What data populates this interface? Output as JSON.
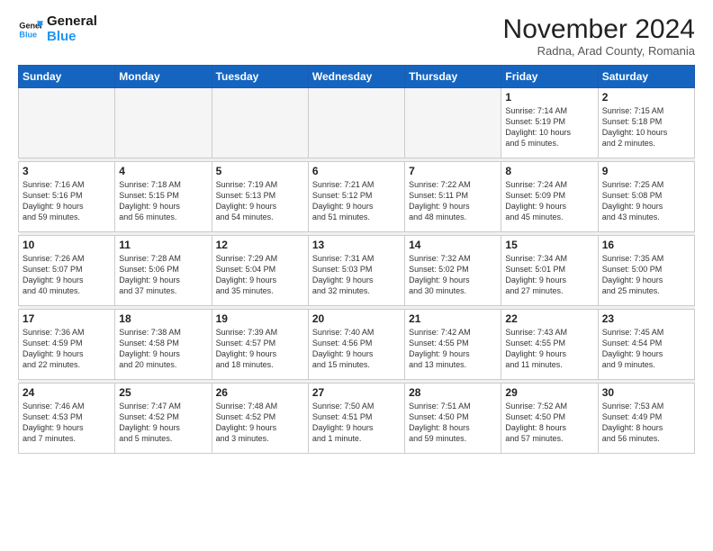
{
  "logo": {
    "line1": "General",
    "line2": "Blue"
  },
  "header": {
    "title": "November 2024",
    "subtitle": "Radna, Arad County, Romania"
  },
  "weekdays": [
    "Sunday",
    "Monday",
    "Tuesday",
    "Wednesday",
    "Thursday",
    "Friday",
    "Saturday"
  ],
  "weeks": [
    [
      {
        "day": "",
        "info": ""
      },
      {
        "day": "",
        "info": ""
      },
      {
        "day": "",
        "info": ""
      },
      {
        "day": "",
        "info": ""
      },
      {
        "day": "",
        "info": ""
      },
      {
        "day": "1",
        "info": "Sunrise: 7:14 AM\nSunset: 5:19 PM\nDaylight: 10 hours\nand 5 minutes."
      },
      {
        "day": "2",
        "info": "Sunrise: 7:15 AM\nSunset: 5:18 PM\nDaylight: 10 hours\nand 2 minutes."
      }
    ],
    [
      {
        "day": "3",
        "info": "Sunrise: 7:16 AM\nSunset: 5:16 PM\nDaylight: 9 hours\nand 59 minutes."
      },
      {
        "day": "4",
        "info": "Sunrise: 7:18 AM\nSunset: 5:15 PM\nDaylight: 9 hours\nand 56 minutes."
      },
      {
        "day": "5",
        "info": "Sunrise: 7:19 AM\nSunset: 5:13 PM\nDaylight: 9 hours\nand 54 minutes."
      },
      {
        "day": "6",
        "info": "Sunrise: 7:21 AM\nSunset: 5:12 PM\nDaylight: 9 hours\nand 51 minutes."
      },
      {
        "day": "7",
        "info": "Sunrise: 7:22 AM\nSunset: 5:11 PM\nDaylight: 9 hours\nand 48 minutes."
      },
      {
        "day": "8",
        "info": "Sunrise: 7:24 AM\nSunset: 5:09 PM\nDaylight: 9 hours\nand 45 minutes."
      },
      {
        "day": "9",
        "info": "Sunrise: 7:25 AM\nSunset: 5:08 PM\nDaylight: 9 hours\nand 43 minutes."
      }
    ],
    [
      {
        "day": "10",
        "info": "Sunrise: 7:26 AM\nSunset: 5:07 PM\nDaylight: 9 hours\nand 40 minutes."
      },
      {
        "day": "11",
        "info": "Sunrise: 7:28 AM\nSunset: 5:06 PM\nDaylight: 9 hours\nand 37 minutes."
      },
      {
        "day": "12",
        "info": "Sunrise: 7:29 AM\nSunset: 5:04 PM\nDaylight: 9 hours\nand 35 minutes."
      },
      {
        "day": "13",
        "info": "Sunrise: 7:31 AM\nSunset: 5:03 PM\nDaylight: 9 hours\nand 32 minutes."
      },
      {
        "day": "14",
        "info": "Sunrise: 7:32 AM\nSunset: 5:02 PM\nDaylight: 9 hours\nand 30 minutes."
      },
      {
        "day": "15",
        "info": "Sunrise: 7:34 AM\nSunset: 5:01 PM\nDaylight: 9 hours\nand 27 minutes."
      },
      {
        "day": "16",
        "info": "Sunrise: 7:35 AM\nSunset: 5:00 PM\nDaylight: 9 hours\nand 25 minutes."
      }
    ],
    [
      {
        "day": "17",
        "info": "Sunrise: 7:36 AM\nSunset: 4:59 PM\nDaylight: 9 hours\nand 22 minutes."
      },
      {
        "day": "18",
        "info": "Sunrise: 7:38 AM\nSunset: 4:58 PM\nDaylight: 9 hours\nand 20 minutes."
      },
      {
        "day": "19",
        "info": "Sunrise: 7:39 AM\nSunset: 4:57 PM\nDaylight: 9 hours\nand 18 minutes."
      },
      {
        "day": "20",
        "info": "Sunrise: 7:40 AM\nSunset: 4:56 PM\nDaylight: 9 hours\nand 15 minutes."
      },
      {
        "day": "21",
        "info": "Sunrise: 7:42 AM\nSunset: 4:55 PM\nDaylight: 9 hours\nand 13 minutes."
      },
      {
        "day": "22",
        "info": "Sunrise: 7:43 AM\nSunset: 4:55 PM\nDaylight: 9 hours\nand 11 minutes."
      },
      {
        "day": "23",
        "info": "Sunrise: 7:45 AM\nSunset: 4:54 PM\nDaylight: 9 hours\nand 9 minutes."
      }
    ],
    [
      {
        "day": "24",
        "info": "Sunrise: 7:46 AM\nSunset: 4:53 PM\nDaylight: 9 hours\nand 7 minutes."
      },
      {
        "day": "25",
        "info": "Sunrise: 7:47 AM\nSunset: 4:52 PM\nDaylight: 9 hours\nand 5 minutes."
      },
      {
        "day": "26",
        "info": "Sunrise: 7:48 AM\nSunset: 4:52 PM\nDaylight: 9 hours\nand 3 minutes."
      },
      {
        "day": "27",
        "info": "Sunrise: 7:50 AM\nSunset: 4:51 PM\nDaylight: 9 hours\nand 1 minute."
      },
      {
        "day": "28",
        "info": "Sunrise: 7:51 AM\nSunset: 4:50 PM\nDaylight: 8 hours\nand 59 minutes."
      },
      {
        "day": "29",
        "info": "Sunrise: 7:52 AM\nSunset: 4:50 PM\nDaylight: 8 hours\nand 57 minutes."
      },
      {
        "day": "30",
        "info": "Sunrise: 7:53 AM\nSunset: 4:49 PM\nDaylight: 8 hours\nand 56 minutes."
      }
    ]
  ]
}
